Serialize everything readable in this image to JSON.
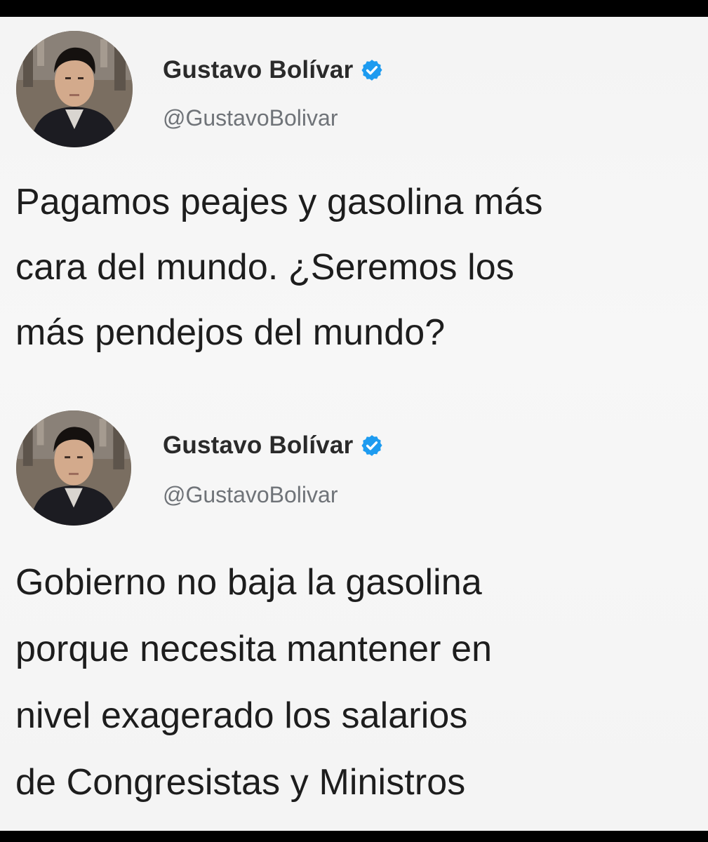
{
  "tweets": [
    {
      "display_name": "Gustavo Bolívar",
      "handle": "@GustavoBolivar",
      "verified_icon": "verified-badge-icon",
      "text": "Pagamos peajes y gasolina más\ncara del mundo. ¿Seremos los\nmás pendejos del mundo?"
    },
    {
      "display_name": "Gustavo Bolívar",
      "handle": "@GustavoBolivar",
      "verified_icon": "verified-badge-icon",
      "text": "Gobierno no baja la gasolina\nporque necesita mantener en\nnivel exagerado los salarios\nde Congresistas y Ministros"
    }
  ],
  "colors": {
    "verified_blue": "#1d9bf0",
    "name_text": "#2a2a2a",
    "handle_text": "#6f7378",
    "body_text": "#1d1d1d",
    "background": "#f4f4f4",
    "frame_border": "#000000"
  }
}
